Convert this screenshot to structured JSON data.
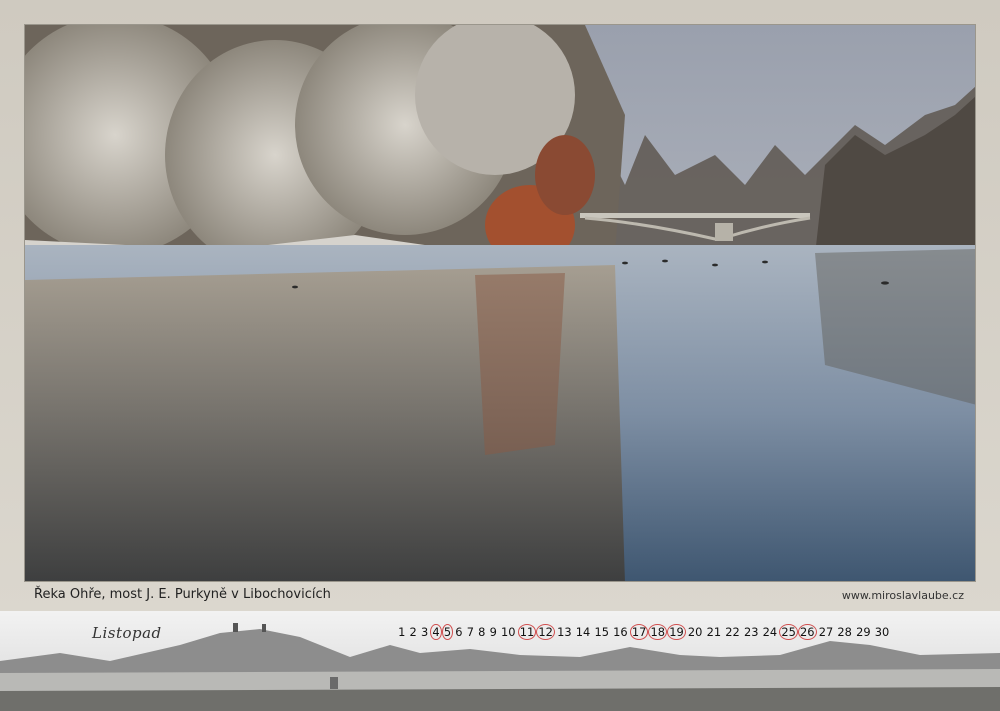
{
  "caption": "Řeka Ohře, most J. E. Purkyně v Libochovicích",
  "website": "www.miroslavlaube.cz",
  "month": "Listopad",
  "days": [
    "1",
    "2",
    "3",
    "4",
    "5",
    "6",
    "7",
    "8",
    "9",
    "10",
    "11",
    "12",
    "13",
    "14",
    "15",
    "16",
    "17",
    "18",
    "19",
    "20",
    "21",
    "22",
    "23",
    "24",
    "25",
    "26",
    "27",
    "28",
    "29",
    "30"
  ],
  "highlighted_days": [
    "4",
    "5",
    "11",
    "12",
    "17",
    "18",
    "19",
    "25",
    "26"
  ]
}
